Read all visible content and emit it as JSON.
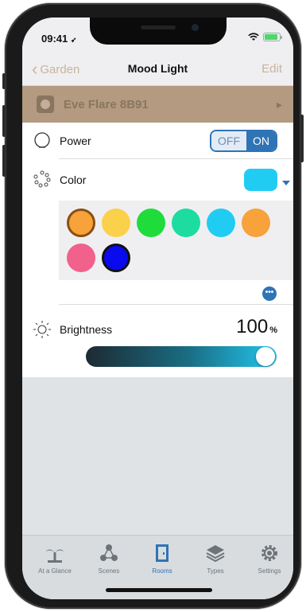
{
  "status_bar": {
    "time": "09:41",
    "location_glyph": "➶"
  },
  "nav": {
    "back_label": "Garden",
    "title": "Mood Light",
    "edit_label": "Edit"
  },
  "accessory": {
    "name": "Eve Flare 8B91"
  },
  "power": {
    "label": "Power",
    "off_label": "OFF",
    "on_label": "ON",
    "state": "ON"
  },
  "color": {
    "label": "Color",
    "selected_color": "#21ccf3",
    "palette": [
      "#f7a23a",
      "#fbd04a",
      "#1fdc3a",
      "#1cdca0",
      "#21ccf3",
      "#f7a23a",
      "#f2608c",
      "#0a0aee"
    ],
    "selected_index": 0,
    "more_label": "•••"
  },
  "brightness": {
    "label": "Brightness",
    "value": "100",
    "unit": "%",
    "level": 1.0
  },
  "tabs": [
    {
      "label": "At a Glance",
      "icon": "palm-tree-icon",
      "active": false
    },
    {
      "label": "Scenes",
      "icon": "scenes-icon",
      "active": false
    },
    {
      "label": "Rooms",
      "icon": "door-icon",
      "active": true
    },
    {
      "label": "Types",
      "icon": "layers-icon",
      "active": false
    },
    {
      "label": "Settings",
      "icon": "gear-icon",
      "active": false
    }
  ],
  "colors": {
    "accent": "#2f74b5",
    "accessory_bar": "#b39a80",
    "nav_tint": "#c9b39a"
  }
}
